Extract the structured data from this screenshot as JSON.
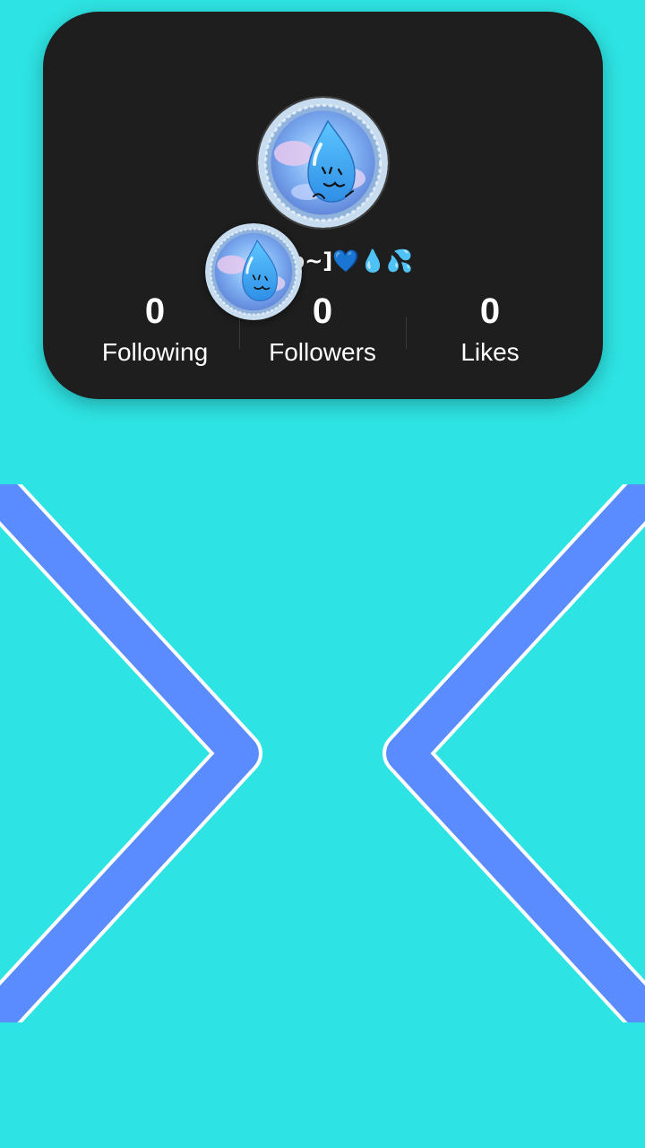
{
  "profile": {
    "username_visible": "💙 lop~]💙💧💦",
    "avatar": "water-drop-character-avatar"
  },
  "stats": {
    "following": {
      "value": "0",
      "label": "Following"
    },
    "followers": {
      "value": "0",
      "label": "Followers"
    },
    "likes": {
      "value": "0",
      "label": "Likes"
    }
  },
  "navigation": {
    "prev_icon": "chevron-right-icon",
    "next_icon": "chevron-left-icon"
  },
  "colors": {
    "background": "#2ee3e3",
    "card": "#1e1e1e",
    "arrow_fill": "#5b8cff",
    "arrow_outline": "#ffffff",
    "text": "#ffffff"
  }
}
